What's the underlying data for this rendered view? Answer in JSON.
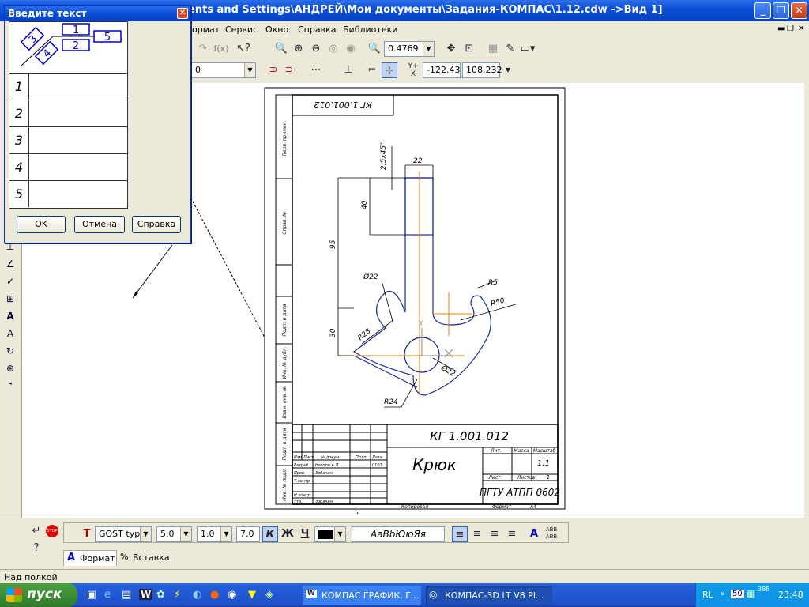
{
  "window": {
    "title": "ents and Settings\\АНДРЕЙ\\Мои документы\\Задания-КОМПАС\\1.12.cdw ->Вид 1]"
  },
  "menu": {
    "items": [
      "Формат",
      "Сервис",
      "Окно",
      "Справка",
      "Библиотеки"
    ],
    "format_visible": "ормат"
  },
  "toolbar": {
    "zoom_value": "0.4769",
    "layer_value": "0",
    "coord_x": "-122.43",
    "coord_y": "108.232",
    "fx_label": "f(x)",
    "coord_icon_label": "Y+\nX"
  },
  "dialog": {
    "title": "Введите текст",
    "cells": [
      "1",
      "2",
      "3",
      "4",
      "5"
    ],
    "rows": [
      "1",
      "2",
      "3",
      "4",
      "5"
    ],
    "ok": "OK",
    "cancel": "Отмена",
    "help": "Справка"
  },
  "drawing": {
    "stamp_rotated": "КГ 1.001.012",
    "designation": "КГ 1.001.012",
    "name": "Крюк",
    "org": "ПГТУ АТПП 0602",
    "scale": "1:1",
    "sheet_label": "Лист",
    "sheets_label": "Листов",
    "sheets_value": "1",
    "lit_label": "Лит.",
    "mass_label": "Масса",
    "scale_label": "Масштаб",
    "copied": "Копировал",
    "format": "Формат",
    "format_value": "А4",
    "table_labels": [
      "Изм.",
      "Лист",
      "№ докум.",
      "Подп.",
      "Дата",
      "Разраб.",
      "Пров.",
      "Т.контр.",
      "Н.контр.",
      "Утв."
    ],
    "table_names": [
      "Нагорн А.Л.",
      "Зобачин",
      "Зобачин"
    ],
    "date": "0101",
    "side_labels": [
      "Перв. примен.",
      "Справ. №",
      "Подп. и дата",
      "Инв. № дубл.",
      "Взам. инв. №",
      "Подп. и дата",
      "Инв. № подл."
    ],
    "dims": {
      "chamfer": "2,5х45°",
      "d22top": "22",
      "d40": "40",
      "d95": "95",
      "d30": "30",
      "phi22a": "Ø22",
      "r28": "R28",
      "r5": "R5",
      "r50": "R50",
      "phi22b": "Ø22",
      "r24": "R24",
      "y_axis": "Y"
    }
  },
  "props": {
    "font": "GOST type",
    "size": "5.0",
    "narrow": "1.0",
    "step": "7.0",
    "bold": "К",
    "italic": "Ж",
    "underline": "Ч",
    "preview": "АаВbЮюЯя",
    "tab_format": "Формат",
    "tab_insert": "Вставка"
  },
  "status": {
    "text": "Над полкой"
  },
  "taskbar": {
    "start": "пуск",
    "task1": "КОМПАС ГРАФИК. Г...",
    "task2": "КОМПАС-3D LT V8 Pl...",
    "lang": "RL",
    "clock": "23:48",
    "tray_num": "50",
    "tray_num2": "388"
  }
}
